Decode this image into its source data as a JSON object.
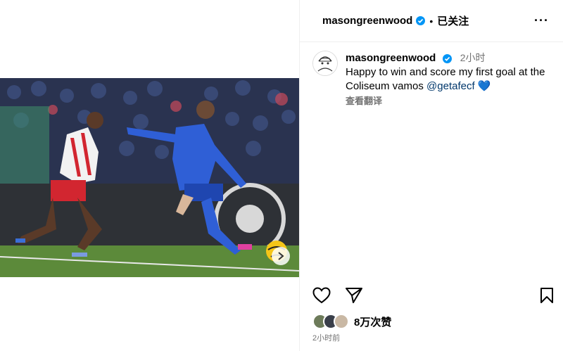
{
  "header": {
    "username": "masongreenwood",
    "separator": "•",
    "follow_label": "已关注",
    "more_label": "···"
  },
  "caption": {
    "username": "masongreenwood",
    "time": "2小时",
    "text_before": "Happy to win and score my first goal at the Coliseum vamos ",
    "mention": "@getafecf",
    "emoji": "💙",
    "translate_label": "查看翻译"
  },
  "photo": {
    "description_icon": "football-photo",
    "slide_count": 3,
    "active_slide": 1
  },
  "likes": {
    "label": "8万次赞"
  },
  "posted_time": "2小时前",
  "colors": {
    "accent": "#0095f6",
    "mention": "#00376b",
    "muted": "#737373"
  }
}
